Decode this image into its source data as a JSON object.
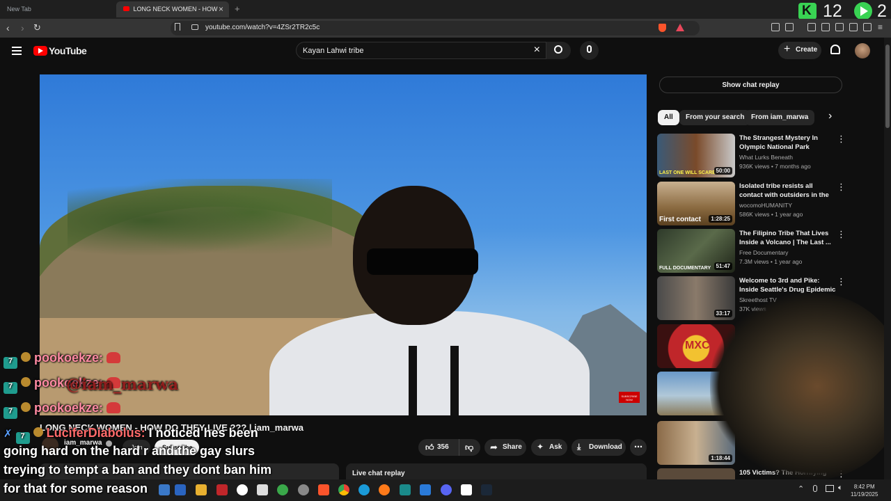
{
  "browser": {
    "tabs": [
      {
        "label": "New Tab"
      },
      {
        "label": "LONG NECK WOMEN - HOW"
      }
    ],
    "url": "youtube.com/watch?v=4ZSr2TR2c5c",
    "counters": {
      "left": "12",
      "right": "2"
    }
  },
  "youtube": {
    "brand": "YouTube",
    "search_value": "Kayan Lahwi tribe",
    "create_label": "Create"
  },
  "video": {
    "title": "LONG NECK WOMEN - HOW DO THEY LIVE ??? | iam_marwa",
    "channel": "iam_marwa",
    "join_label": "Join",
    "subscribe_label": "Subscribe",
    "likes": "356",
    "share_label": "Share",
    "ask_label": "Ask",
    "download_label": "Download",
    "overlay_subscribe": "SUBSCRIBE NOW",
    "live_chat_label": "Live chat replay"
  },
  "sidebar": {
    "show_chat": "Show chat replay",
    "chips": [
      "All",
      "From your search",
      "From iam_marwa"
    ],
    "recommendations": [
      {
        "title": "The Strangest Mystery In Olympic National Park",
        "channel": "What Lurks Beneath",
        "meta": "936K views • 7 months ago",
        "duration": "50:00",
        "caption": "LAST ONE WILL SCARE"
      },
      {
        "title": "Isolated tribe resists all contact with outsiders in the Peruvian ...",
        "channel": "wocomoHUMANITY",
        "meta": "586K views • 1 year ago",
        "duration": "1:28:25",
        "caption": "First contact"
      },
      {
        "title": "The Filipino Tribe That Lives Inside a Volcano | The Last ...",
        "channel": "Free Documentary",
        "meta": "7.3M views • 1 year ago",
        "duration": "51:47",
        "caption": "FULL DOCUMENTARY"
      },
      {
        "title": "Welcome to 3rd and Pike: Inside Seattle's Drug Epidemic",
        "channel": "Skreethost TV",
        "meta": "37K views",
        "duration": "33:17",
        "caption": ""
      },
      {
        "title": "",
        "channel": "",
        "meta": "",
        "duration": "",
        "caption": "MXC"
      },
      {
        "title": "",
        "channel": "",
        "meta": "",
        "duration": "",
        "caption": ""
      },
      {
        "title": "",
        "channel": "",
        "meta": "",
        "duration": "1:18:44",
        "caption": ""
      },
      {
        "title": "105 Victims? The Horrifying",
        "channel": "",
        "meta": "",
        "duration": "",
        "caption": ""
      }
    ]
  },
  "chat_overlay": {
    "lines": [
      {
        "user": "pookoekze:"
      },
      {
        "user": "pookoekze:",
        "ghost": "@iam_marwa"
      },
      {
        "user": "pookoekze:"
      }
    ],
    "last_user": "LuciferDiabolus:",
    "message_lines": [
      "I noticed hes been",
      "going hard on the hard r and the gay slurs",
      "treying to tempt a ban and they dont ban him",
      "for that for some reason"
    ]
  },
  "taskbar": {
    "time": "8:42 PM",
    "date": "11/19/2025"
  },
  "colors": {
    "yt_red": "#ff0000",
    "accent_green": "#39d353",
    "chat_name": "#ff8aa3"
  }
}
